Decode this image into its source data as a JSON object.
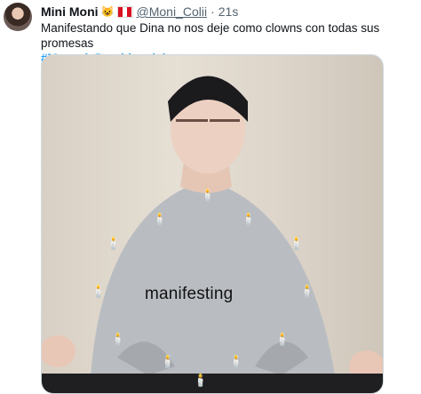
{
  "tweet": {
    "author_name": "Mini Moni",
    "author_emoji": "😺",
    "handle": "@Moni_Colii",
    "separator": "·",
    "time": "21s",
    "text_line": "Manifestando que Dina no nos deje como clowns con todas sus promesas",
    "hashtag": "#MensajePresidencial"
  },
  "media": {
    "caption": "manifesting",
    "candle_icon": "🕯️",
    "candle_count": 15
  },
  "colors": {
    "link": "#1d9bf0",
    "text": "#0f1419",
    "muted": "#536471"
  }
}
